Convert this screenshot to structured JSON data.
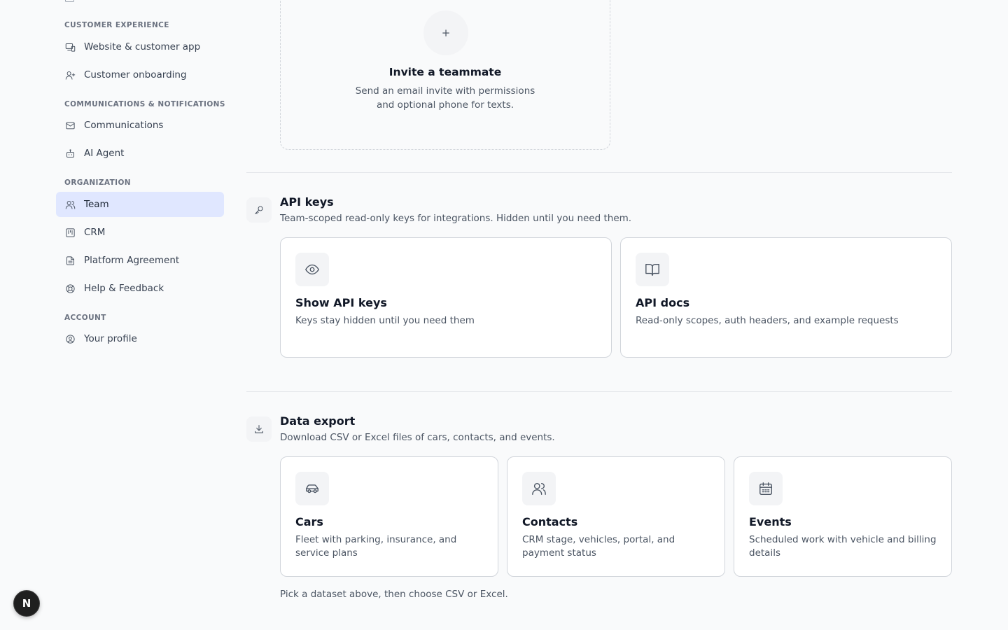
{
  "sidebar": {
    "sections": [
      {
        "title": "CUSTOMER EXPERIENCE",
        "items": [
          {
            "label": "Website & customer app",
            "icon": "devices-icon"
          },
          {
            "label": "Customer onboarding",
            "icon": "user-plus-icon"
          }
        ]
      },
      {
        "title": "COMMUNICATIONS & NOTIFICATIONS",
        "items": [
          {
            "label": "Communications",
            "icon": "mail-icon"
          },
          {
            "label": "AI Agent",
            "icon": "bot-icon"
          }
        ]
      },
      {
        "title": "ORGANIZATION",
        "items": [
          {
            "label": "Team",
            "icon": "users-icon",
            "active": true
          },
          {
            "label": "CRM",
            "icon": "kanban-icon"
          },
          {
            "label": "Platform Agreement",
            "icon": "document-icon"
          },
          {
            "label": "Help & Feedback",
            "icon": "lifebuoy-icon"
          }
        ]
      },
      {
        "title": "ACCOUNT",
        "items": [
          {
            "label": "Your profile",
            "icon": "user-circle-icon"
          }
        ]
      }
    ]
  },
  "invite": {
    "plus": "+",
    "title": "Invite a teammate",
    "description": "Send an email invite with permissions and optional phone for texts."
  },
  "api_keys": {
    "title": "API keys",
    "description": "Team-scoped read-only keys for integrations. Hidden until you need them.",
    "icon": "key-icon",
    "cards": [
      {
        "title": "Show API keys",
        "description": "Keys stay hidden until you need them",
        "icon": "eye-icon"
      },
      {
        "title": "API docs",
        "description": "Read-only scopes, auth headers, and example requests",
        "icon": "book-icon"
      }
    ]
  },
  "data_export": {
    "title": "Data export",
    "description": "Download CSV or Excel files of cars, contacts, and events.",
    "icon": "download-icon",
    "cards": [
      {
        "title": "Cars",
        "description": "Fleet with parking, insurance, and service plans",
        "icon": "car-icon"
      },
      {
        "title": "Contacts",
        "description": "CRM stage, vehicles, portal, and payment status",
        "icon": "users-icon"
      },
      {
        "title": "Events",
        "description": "Scheduled work with vehicle and billing details",
        "icon": "calendar-icon"
      }
    ],
    "hint": "Pick a dataset above, then choose CSV or Excel."
  },
  "badge": {
    "letter": "N"
  }
}
